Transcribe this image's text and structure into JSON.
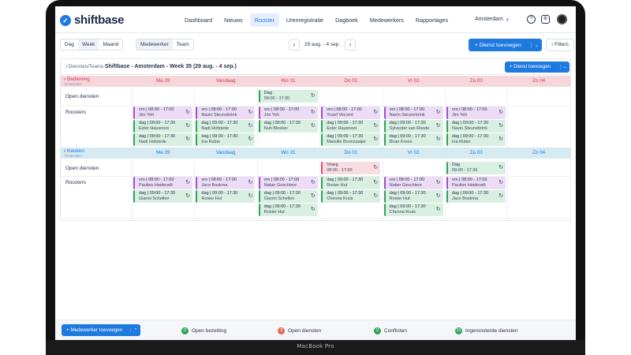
{
  "app": {
    "logo_text": "shiftbase",
    "logo_mark": "✓"
  },
  "nav": {
    "items": [
      "Dashboard",
      "Nieuws",
      "Rooster",
      "Urenregistratie",
      "Dagboek",
      "Medewerkers",
      "Rapportages"
    ],
    "active": "Rooster",
    "location": "Amsterdam"
  },
  "toolbar": {
    "views": [
      "Dag",
      "Week",
      "Maand"
    ],
    "active_view": "Week",
    "groupings": [
      "Medewerker",
      "Team"
    ],
    "active_grouping": "Medewerker",
    "date_range": "29 aug. - 4 sep.",
    "add_shift": "Dienst toevoegen",
    "filters": "Filters"
  },
  "panel": {
    "crumb_prefix": "Diensten/Teams",
    "crumb_title": "Shiftbase - Amsterdam - Week 35 (29 aug. - 4 sep.)",
    "add_shift": "Dienst toevoegen"
  },
  "days": [
    "Ma 29",
    "Vandaag",
    "Wo 31",
    "Do 01",
    "Vr 02",
    "Za 03",
    "Zo 04"
  ],
  "departments": [
    {
      "name": "Bediening",
      "sub": "Amsterdam",
      "color": "#f6d6da",
      "text_color": "#d13b55",
      "open_label": "Open diensten",
      "roster_label": "Roosters",
      "open": [
        {
          "day": 2,
          "type": "g",
          "line1": "Dag",
          "line2": "09:00 - 17:30"
        }
      ],
      "roster": [
        {
          "day": 0,
          "row": 0,
          "type": "p",
          "line1": "vro | 08:00 - 17:00",
          "line2": "Jim Yeh"
        },
        {
          "day": 0,
          "row": 1,
          "type": "g",
          "line1": "dag | 09:00 - 17:30",
          "line2": "Ester Hausnoot"
        },
        {
          "day": 0,
          "row": 2,
          "type": "g",
          "line1": "dag | 09:00 - 17:30",
          "line2": "Nadi Hofstede"
        },
        {
          "day": 1,
          "row": 0,
          "type": "p",
          "line1": "vro | 08:00 - 17:00",
          "line2": "Navin Steunebrink"
        },
        {
          "day": 1,
          "row": 1,
          "type": "g",
          "line1": "dag | 09:00 - 17:30",
          "line2": "Nadi Hofstede"
        },
        {
          "day": 1,
          "row": 2,
          "type": "g",
          "line1": "dag | 09:00 - 17:30",
          "line2": "Ina Rubio"
        },
        {
          "day": 2,
          "row": 0,
          "type": "p",
          "line1": "vro | 08:00 - 17:00",
          "line2": "Jim Yeh"
        },
        {
          "day": 2,
          "row": 1,
          "type": "g",
          "line1": "dag | 09:00 - 17:30",
          "line2": "Nuh Bleeker"
        },
        {
          "day": 3,
          "row": 0,
          "type": "p",
          "line1": "vro | 08:00 - 17:00",
          "line2": "Yusef Vincent"
        },
        {
          "day": 3,
          "row": 1,
          "type": "g",
          "line1": "dag | 09:00 - 17:30",
          "line2": "Ester Hausnoot"
        },
        {
          "day": 3,
          "row": 2,
          "type": "g",
          "line1": "dag | 09:00 - 17:30",
          "line2": "Mareille Boonzaaijer"
        },
        {
          "day": 4,
          "row": 0,
          "type": "p",
          "line1": "vro | 08:00 - 17:00",
          "line2": "Navin Steunebrink"
        },
        {
          "day": 4,
          "row": 1,
          "type": "g",
          "line1": "dag | 09:00 - 17:30",
          "line2": "Sylvester van Roode"
        },
        {
          "day": 4,
          "row": 2,
          "type": "g",
          "line1": "dag | 09:00 - 17:30",
          "line2": "Brian Kroos"
        },
        {
          "day": 5,
          "row": 0,
          "type": "p",
          "line1": "vro | 08:00 - 17:00",
          "line2": "Jim Yeh"
        },
        {
          "day": 5,
          "row": 1,
          "type": "g",
          "line1": "dag | 09:00 - 17:30",
          "line2": "Navin Steunebrink"
        },
        {
          "day": 5,
          "row": 2,
          "type": "g",
          "line1": "dag | 09:00 - 17:30",
          "line2": "Ina Rubio"
        }
      ]
    },
    {
      "name": "Keuken",
      "sub": "Amsterdam",
      "color": "#d6eaf2",
      "text_color": "#1f7ae0",
      "open_label": "Open diensten",
      "roster_label": "Roosters",
      "open": [
        {
          "day": 3,
          "type": "r",
          "line1": "Vroeg",
          "line2": "08:00 - 17:00"
        },
        {
          "day": 5,
          "type": "g",
          "line1": "Dag",
          "line2": "09:00 - 17:30"
        }
      ],
      "roster": [
        {
          "day": 0,
          "row": 0,
          "type": "p",
          "line1": "vro | 08:00 - 17:00",
          "line2": "Paulien Heidevelt"
        },
        {
          "day": 0,
          "row": 1,
          "type": "g",
          "line1": "dag | 09:00 - 17:30",
          "line2": "Gianni Schellen"
        },
        {
          "day": 1,
          "row": 0,
          "type": "p",
          "line1": "vro | 08:00 - 17:00",
          "line2": "Jaco Boskma"
        },
        {
          "day": 1,
          "row": 1,
          "type": "g",
          "line1": "dag | 09:00 - 17:30",
          "line2": "Rosier Hut"
        },
        {
          "day": 2,
          "row": 0,
          "type": "p",
          "line1": "vro | 08:00 - 17:00",
          "line2": "Natan Geschiere"
        },
        {
          "day": 2,
          "row": 1,
          "type": "g",
          "line1": "dag | 09:00 - 17:30",
          "line2": "Gianni Schellen"
        },
        {
          "day": 2,
          "row": 2,
          "type": "g",
          "line1": "dag | 09:00 - 17:30",
          "line2": "Rosier Hut"
        },
        {
          "day": 3,
          "row": 0,
          "type": "g",
          "line1": "dag | 09:00 - 17:30",
          "line2": "Rosier Hut"
        },
        {
          "day": 3,
          "row": 1,
          "type": "g",
          "line1": "dag | 09:00 - 17:30",
          "line2": "Chenna Kruis"
        },
        {
          "day": 4,
          "row": 0,
          "type": "p",
          "line1": "vro | 08:00 - 17:00",
          "line2": "Natan Geschiere"
        },
        {
          "day": 4,
          "row": 1,
          "type": "g",
          "line1": "dag | 09:00 - 17:30",
          "line2": "Rosier Hut"
        },
        {
          "day": 4,
          "row": 2,
          "type": "g",
          "line1": "dag | 09:00 - 17:30",
          "line2": "Chenna Kruis"
        },
        {
          "day": 5,
          "row": 0,
          "type": "p",
          "line1": "vro | 08:00 - 17:00",
          "line2": "Paulien Heidevelt"
        },
        {
          "day": 5,
          "row": 1,
          "type": "g",
          "line1": "dag | 09:00 - 17:30",
          "line2": "Jaco Boskma"
        }
      ]
    }
  ],
  "footer": {
    "add_employee": "Medewerker toevoegen",
    "stats": [
      {
        "count": "0",
        "label": "Open bezetting",
        "color": "#2fa35b"
      },
      {
        "count": "3",
        "label": "Open diensten",
        "color": "#e8674a"
      },
      {
        "count": "0",
        "label": "Conflicten",
        "color": "#2fa35b"
      },
      {
        "count": "31",
        "label": "Ingeroosterde diensten",
        "color": "#2fa35b"
      }
    ]
  },
  "device": {
    "label": "MacBook Pro"
  },
  "colors": {
    "accent": "#1f7ae0"
  }
}
